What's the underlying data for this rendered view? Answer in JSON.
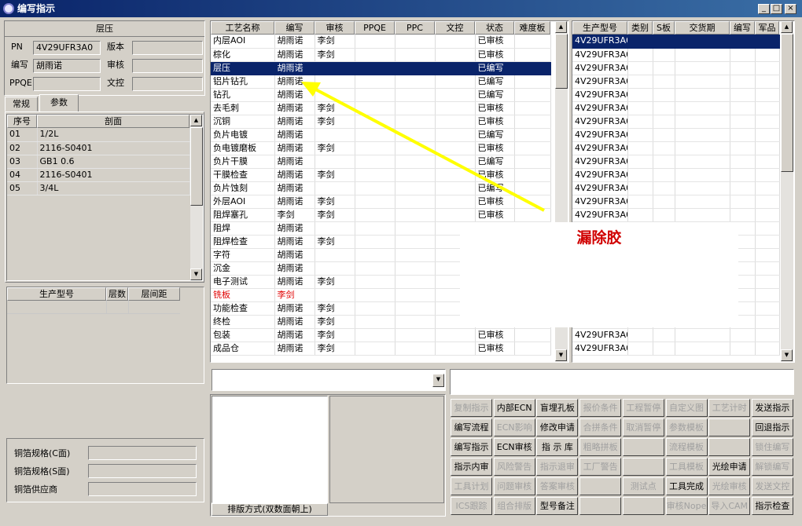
{
  "window": {
    "title": "编写指示",
    "min": "_",
    "max": "□",
    "close": "×"
  },
  "left": {
    "section_title": "层压",
    "pn_label": "PN",
    "pn_value": "4V29UFR3A0",
    "version_label": "版本",
    "version_value": "",
    "writer_label": "编写",
    "writer_value": "胡雨诺",
    "reviewer_label": "审核",
    "reviewer_value": "",
    "ppqe_label": "PPQE",
    "ppqe_value": "",
    "doc_label": "文控",
    "doc_value": "",
    "tabs": [
      "常规",
      "参数"
    ],
    "layer_headers": [
      "序号",
      "剖面"
    ],
    "layers": [
      [
        "01",
        "1/2L"
      ],
      [
        "02",
        "2116-S0401"
      ],
      [
        "03",
        "GB1  0.6"
      ],
      [
        "04",
        "2116-S0401"
      ],
      [
        "05",
        "3/4L"
      ]
    ],
    "model_headers": [
      "生产型号",
      "层数",
      "层间距"
    ],
    "copper_c_label": "铜箔规格(C面)",
    "copper_s_label": "铜箔规格(S面)",
    "copper_vendor_label": "铜箔供应商"
  },
  "process": {
    "headers": [
      "工艺名称",
      "编写",
      "审核",
      "PPQE",
      "PPC",
      "文控",
      "状态",
      "难度板"
    ],
    "rows": [
      [
        "内层AOI",
        "胡雨诺",
        "李剑",
        "",
        "",
        "",
        "已审核",
        ""
      ],
      [
        "棕化",
        "胡雨诺",
        "李剑",
        "",
        "",
        "",
        "已审核",
        ""
      ],
      [
        "层压",
        "胡雨诺",
        "",
        "",
        "",
        "",
        "已编写",
        ""
      ],
      [
        "铝片钻孔",
        "胡雨诺",
        "",
        "",
        "",
        "",
        "已编写",
        ""
      ],
      [
        "钻孔",
        "胡雨诺",
        "",
        "",
        "",
        "",
        "已编写",
        ""
      ],
      [
        "去毛刺",
        "胡雨诺",
        "李剑",
        "",
        "",
        "",
        "已审核",
        ""
      ],
      [
        "沉铜",
        "胡雨诺",
        "李剑",
        "",
        "",
        "",
        "已审核",
        ""
      ],
      [
        "负片电镀",
        "胡雨诺",
        "",
        "",
        "",
        "",
        "已编写",
        ""
      ],
      [
        "负电镀磨板",
        "胡雨诺",
        "李剑",
        "",
        "",
        "",
        "已审核",
        ""
      ],
      [
        "负片干膜",
        "胡雨诺",
        "",
        "",
        "",
        "",
        "已编写",
        ""
      ],
      [
        "干膜检查",
        "胡雨诺",
        "李剑",
        "",
        "",
        "",
        "已审核",
        ""
      ],
      [
        "负片蚀刻",
        "胡雨诺",
        "",
        "",
        "",
        "",
        "已编写",
        ""
      ],
      [
        "外层AOI",
        "胡雨诺",
        "李剑",
        "",
        "",
        "",
        "已审核",
        ""
      ],
      [
        "阻焊塞孔",
        "李剑",
        "李剑",
        "",
        "",
        "",
        "已审核",
        ""
      ],
      [
        "阻焊",
        "胡雨诺",
        "",
        "",
        "",
        "",
        "",
        ""
      ],
      [
        "阻焊检查",
        "胡雨诺",
        "李剑",
        "",
        "",
        "",
        "",
        ""
      ],
      [
        "字符",
        "胡雨诺",
        "",
        "",
        "",
        "",
        "",
        ""
      ],
      [
        "沉金",
        "胡雨诺",
        "",
        "",
        "",
        "",
        "",
        ""
      ],
      [
        "电子测试",
        "胡雨诺",
        "李剑",
        "",
        "",
        "",
        "",
        ""
      ],
      [
        "铣板",
        "李剑",
        "",
        "",
        "",
        "",
        "",
        ""
      ],
      [
        "功能检查",
        "胡雨诺",
        "李剑",
        "",
        "",
        "",
        "",
        ""
      ],
      [
        "终检",
        "胡雨诺",
        "李剑",
        "",
        "",
        "",
        "",
        ""
      ],
      [
        "包装",
        "胡雨诺",
        "李剑",
        "",
        "",
        "",
        "已审核",
        ""
      ],
      [
        "成品仓",
        "胡雨诺",
        "李剑",
        "",
        "",
        "",
        "已审核",
        ""
      ]
    ]
  },
  "models": {
    "headers": [
      "生产型号",
      "类别",
      "S板",
      "交货期",
      "编写",
      "军品"
    ],
    "first_rows": [
      "4V29UFR3A0",
      "4V29UFR3A0",
      "4V29UFR3A0",
      "4V29UFR3A0",
      "4V29UFR3A0",
      "4V29UFR3A0",
      "4V29UFR3A0",
      "4V29UFR3A0",
      "4V29UFR3A0",
      "4V29UFR3A0",
      "4V29UFR3A0",
      "4V29UFR3A0",
      "4V29UFR3A0",
      "4V29UFR3A0"
    ],
    "last_rows": [
      "4V29UFR3A0",
      "4V29UFR3A0"
    ]
  },
  "annotation": {
    "text": "漏除胶",
    "arrow_color": "#ffff00",
    "text_color": "#d00000"
  },
  "bottom": {
    "layout_label": "排版方式(双数面朝上)"
  },
  "buttons": [
    [
      "复制指示",
      "内部ECN",
      "盲埋孔板",
      "报价条件",
      "工程暂停",
      "自定义图",
      "工艺计时",
      "发送指示"
    ],
    [
      "编写流程",
      "ECN影响",
      "修改申请",
      "合拼条件",
      "取消暂停",
      "参数模板",
      "",
      "回退指示"
    ],
    [
      "编写指示",
      "ECN审核",
      "指 示 库",
      "粗略拼板",
      "",
      "流程模板",
      "",
      "锁住编写"
    ],
    [
      "指示内审",
      "风险警告",
      "指示退审",
      "工厂警告",
      "",
      "工具模板",
      "光绘申请",
      "解锁编写"
    ],
    [
      "工具计划",
      "问题审核",
      "答案审核",
      "",
      "测试点",
      "工具完成",
      "光绘审核",
      "发送文控"
    ],
    [
      "ICS跟踪",
      "组合排版",
      "型号备注",
      "",
      "",
      "审核Nope",
      "导入CAM",
      "指示检查"
    ]
  ],
  "buttons_enabled": [
    [
      0,
      1,
      1,
      0,
      0,
      0,
      0,
      1
    ],
    [
      1,
      0,
      1,
      0,
      0,
      0,
      0,
      1
    ],
    [
      1,
      1,
      1,
      0,
      0,
      0,
      0,
      0
    ],
    [
      1,
      0,
      0,
      0,
      0,
      0,
      1,
      0
    ],
    [
      0,
      0,
      0,
      0,
      0,
      1,
      0,
      0
    ],
    [
      0,
      0,
      1,
      0,
      0,
      0,
      0,
      1
    ]
  ]
}
